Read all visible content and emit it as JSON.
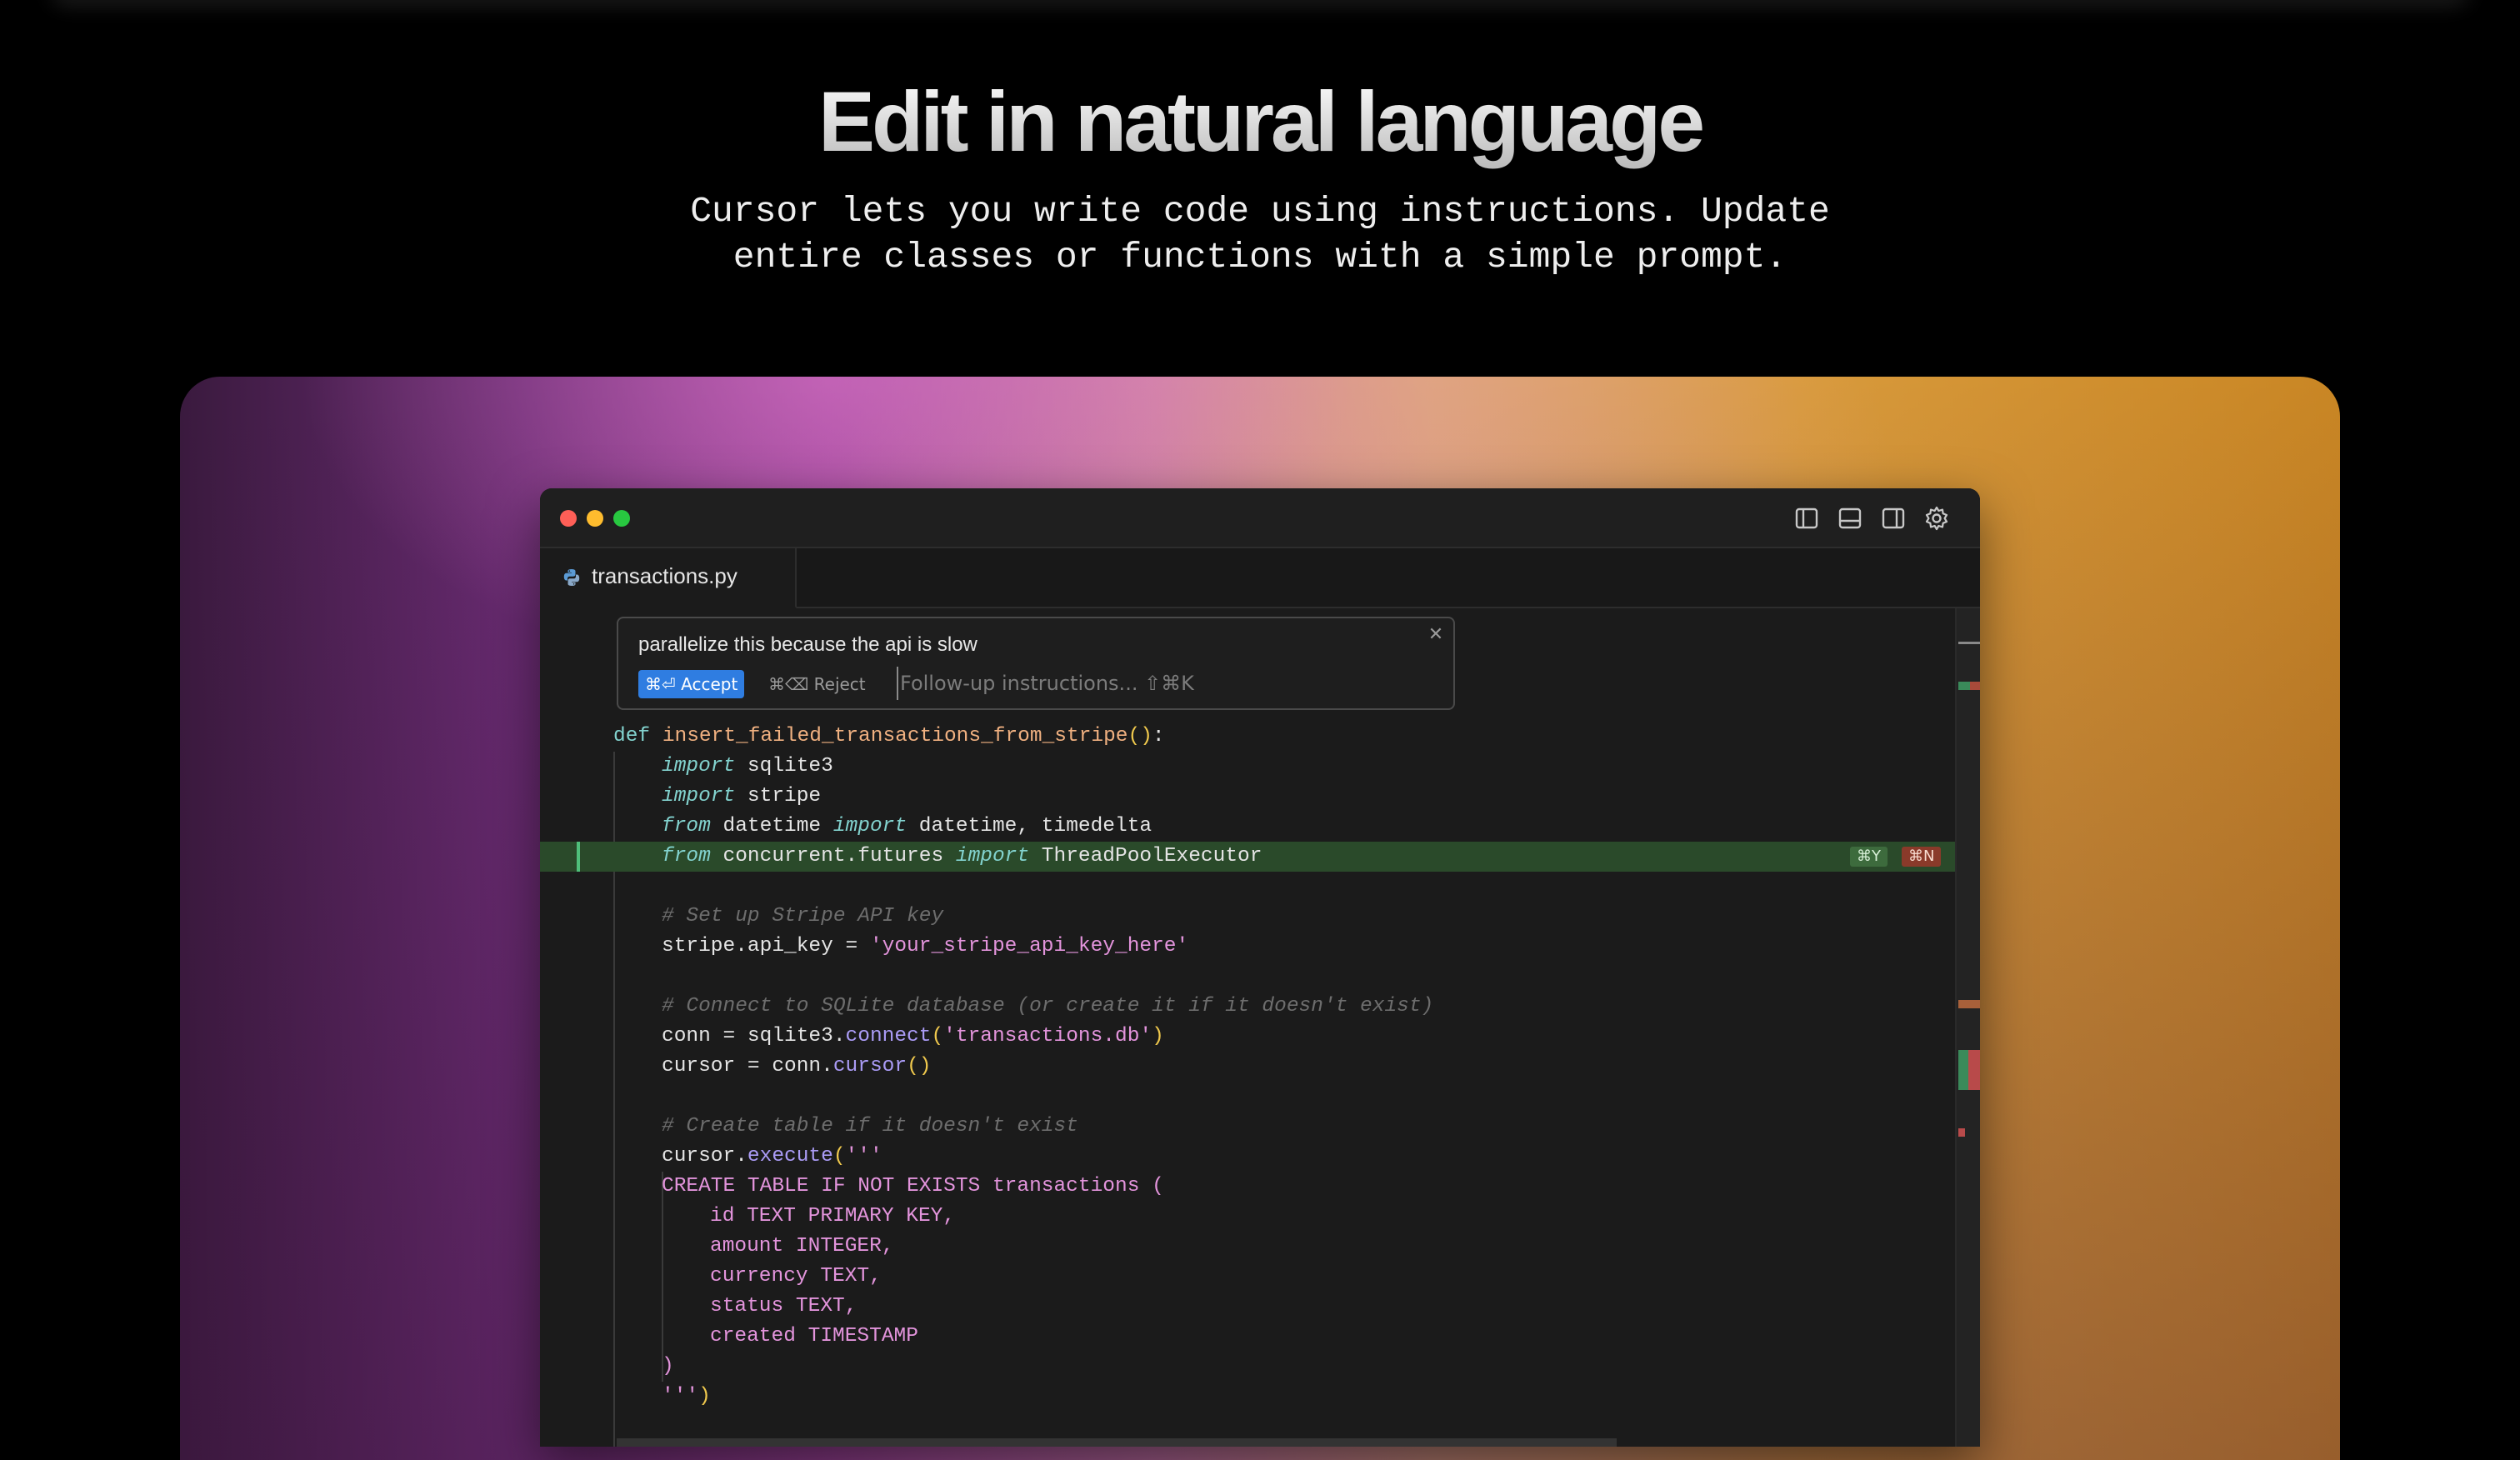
{
  "hero": {
    "title": "Edit in natural language",
    "subtitle_line1": "Cursor lets you write code using instructions. Update",
    "subtitle_line2": "entire classes or functions with a simple prompt."
  },
  "colors": {
    "accent_button": "#2f7de1",
    "added_line_bg": "#2a4a2a",
    "keep_badge": "#3d6b3d",
    "reject_badge": "#8a3a2a"
  },
  "editor": {
    "tab": {
      "filename": "transactions.py",
      "icon": "python-file-icon"
    },
    "toolbar_icons": [
      "toggle-left-sidebar-icon",
      "toggle-panel-icon",
      "toggle-right-sidebar-icon",
      "settings-gear-icon"
    ],
    "prompt": {
      "text": "parallelize this because the api is slow",
      "accept_label": "⌘⏎ Accept",
      "reject_label": "⌘⌫ Reject",
      "followup_placeholder": "Follow-up instructions... ⇧⌘K"
    },
    "diff_badges": {
      "keep": "⌘Y",
      "reject": "⌘N"
    },
    "code": {
      "l1_def": "def",
      "l1_name": "insert_failed_transactions_from_stripe",
      "l1_paren": "()",
      "l1_colon": ":",
      "l2_kw": "import",
      "l2_rest": " sqlite3",
      "l3_kw": "import",
      "l3_rest": " stripe",
      "l4_kw1": "from",
      "l4_mid": " datetime ",
      "l4_kw2": "import",
      "l4_rest": " datetime, timedelta",
      "l5_kw1": "from",
      "l5_mid": " concurrent.futures ",
      "l5_kw2": "import",
      "l5_rest": " ThreadPoolExecutor",
      "c1": "# Set up Stripe API key",
      "l8_a": "stripe.api_key = ",
      "l8_str": "'your_stripe_api_key_here'",
      "c2": "# Connect to SQLite database (or create it if it doesn't exist)",
      "l11_a": "conn = sqlite3.",
      "l11_call": "connect",
      "l11_p1": "(",
      "l11_str": "'transactions.db'",
      "l11_p2": ")",
      "l12_a": "cursor = conn.",
      "l12_call": "cursor",
      "l12_p": "()",
      "c3": "# Create table if it doesn't exist",
      "l15_a": "cursor.",
      "l15_call": "execute",
      "l15_p": "(",
      "l15_str": "'''",
      "s1": "CREATE TABLE IF NOT EXISTS transactions (",
      "s2": "id TEXT PRIMARY KEY,",
      "s3": "amount INTEGER,",
      "s4": "currency TEXT,",
      "s5": "status TEXT,",
      "s6": "created TIMESTAMP",
      "s7": ")",
      "s8_str": "'''",
      "s8_p": ")"
    }
  }
}
